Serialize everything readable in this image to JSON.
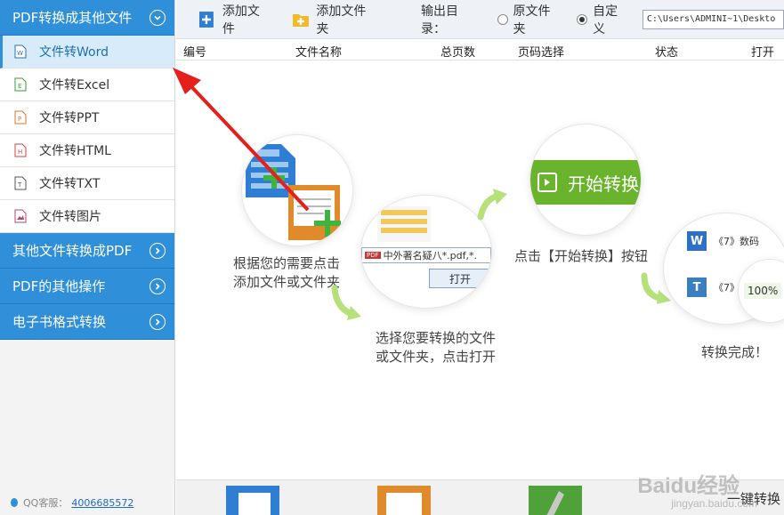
{
  "sidebar": {
    "sections": [
      {
        "label": "PDF转换成其他文件",
        "expanded": true
      },
      {
        "label": "其他文件转换成PDF",
        "expanded": false
      },
      {
        "label": "PDF的其他操作",
        "expanded": false
      },
      {
        "label": "电子书格式转换",
        "expanded": false
      }
    ],
    "items": [
      {
        "label": "文件转Word",
        "icon": "word-file-icon",
        "active": true
      },
      {
        "label": "文件转Excel",
        "icon": "excel-file-icon",
        "active": false
      },
      {
        "label": "文件转PPT",
        "icon": "ppt-file-icon",
        "active": false
      },
      {
        "label": "文件转HTML",
        "icon": "html-file-icon",
        "active": false
      },
      {
        "label": "文件转TXT",
        "icon": "txt-file-icon",
        "active": false
      },
      {
        "label": "文件转图片",
        "icon": "image-file-icon",
        "active": false
      }
    ],
    "qq_label": "QQ客服：",
    "qq_number": "4006685572"
  },
  "toolbar": {
    "add_file": "添加文件",
    "add_folder": "添加文件夹",
    "output_label": "输出目录：",
    "radio_original": "原文件夹",
    "radio_custom": "自定义",
    "selected": "custom",
    "path": "C:\\Users\\ADMINI~1\\Deskto"
  },
  "table": {
    "headers": [
      "编号",
      "文件名称",
      "总页数",
      "页码选择",
      "状态",
      "打开"
    ]
  },
  "steps": {
    "step1": "根据您的需要点击\n添加文件或文件夹",
    "step2": "选择您要转换的文件\n或文件夹，点击打开",
    "step3": "点击【开始转换】按钮",
    "step4": "转换完成！",
    "start_button": "开始转换",
    "open_button": "打开",
    "file_row": "中外著名疑",
    "file_ext": "八*.pdf,*.",
    "doc_row1": "《7》数码",
    "doc_row2": "《7》",
    "progress": "100%"
  },
  "bottom": {
    "convert_label": "一键转换"
  },
  "watermark": {
    "main": "Baidu经验",
    "sub": "jingyan.baidu.com"
  },
  "colors": {
    "accent_blue": "#2f8fd8",
    "green": "#6ab42d",
    "red_arrow": "#e5201c"
  }
}
